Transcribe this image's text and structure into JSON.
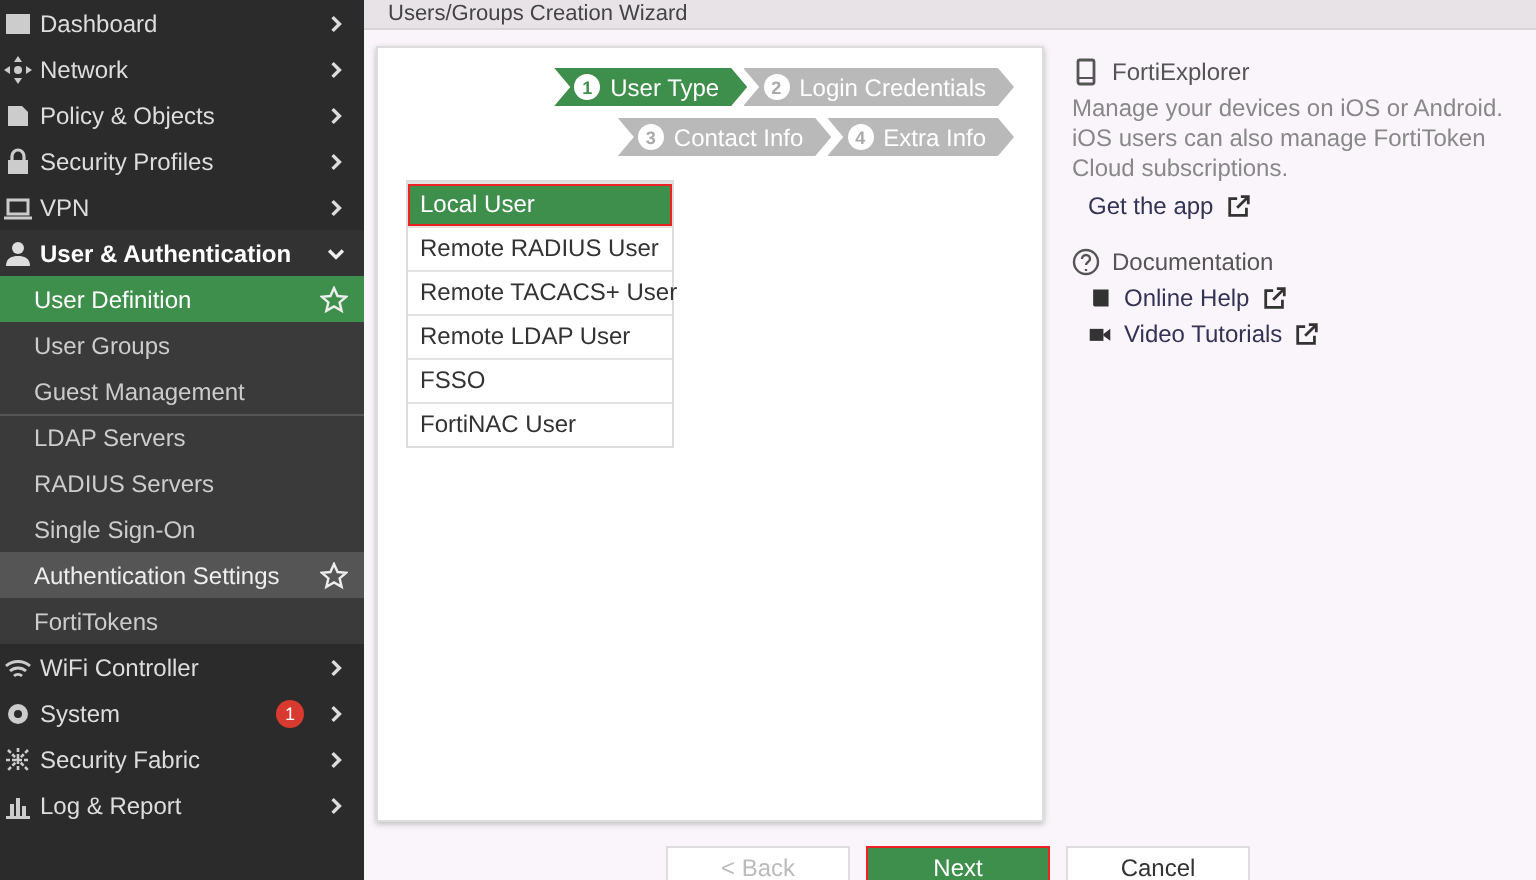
{
  "sidebar": {
    "items": [
      {
        "label": "Dashboard",
        "expanded": false
      },
      {
        "label": "Network",
        "expanded": false
      },
      {
        "label": "Policy & Objects",
        "expanded": false
      },
      {
        "label": "Security Profiles",
        "expanded": false
      },
      {
        "label": "VPN",
        "expanded": false
      },
      {
        "label": "User & Authentication",
        "expanded": true,
        "children": [
          {
            "label": "User Definition",
            "selected": true,
            "hovered": false,
            "divider_before": false
          },
          {
            "label": "User Groups",
            "selected": false,
            "hovered": false,
            "divider_before": false
          },
          {
            "label": "Guest Management",
            "selected": false,
            "hovered": false,
            "divider_before": false
          },
          {
            "label": "LDAP Servers",
            "selected": false,
            "hovered": false,
            "divider_before": true
          },
          {
            "label": "RADIUS Servers",
            "selected": false,
            "hovered": false,
            "divider_before": false
          },
          {
            "label": "Single Sign-On",
            "selected": false,
            "hovered": false,
            "divider_before": false
          },
          {
            "label": "Authentication Settings",
            "selected": false,
            "hovered": true,
            "divider_before": false
          },
          {
            "label": "FortiTokens",
            "selected": false,
            "hovered": false,
            "divider_before": false
          }
        ]
      },
      {
        "label": "WiFi Controller",
        "expanded": false
      },
      {
        "label": "System",
        "expanded": false,
        "badge": "1"
      },
      {
        "label": "Security Fabric",
        "expanded": false
      },
      {
        "label": "Log & Report",
        "expanded": false
      }
    ]
  },
  "wizard": {
    "title": "Users/Groups Creation Wizard",
    "steps": [
      {
        "number": "1",
        "label": "User Type",
        "selected": true
      },
      {
        "number": "2",
        "label": "Login Credentials",
        "selected": false
      },
      {
        "number": "3",
        "label": "Contact Info",
        "selected": false
      },
      {
        "number": "4",
        "label": "Extra Info",
        "selected": false
      }
    ],
    "user_types": [
      {
        "label": "Local User",
        "selected": true
      },
      {
        "label": "Remote RADIUS User",
        "selected": false
      },
      {
        "label": "Remote TACACS+ User",
        "selected": false
      },
      {
        "label": "Remote LDAP User",
        "selected": false
      },
      {
        "label": "FSSO",
        "selected": false
      },
      {
        "label": "FortiNAC User",
        "selected": false
      }
    ],
    "buttons": [
      {
        "label": "< Back",
        "kind": "secondary",
        "disabled": true
      },
      {
        "label": "Next",
        "kind": "primary",
        "disabled": false
      },
      {
        "label": "Cancel",
        "kind": "secondary",
        "disabled": false
      }
    ]
  },
  "info_panel": {
    "fortiexplorer": {
      "title": "FortiExplorer",
      "description": "Manage your devices on iOS or Android. iOS users can also manage FortiToken Cloud subscriptions.",
      "link": "Get the app"
    },
    "documentation": {
      "title": "Documentation",
      "links": [
        "Online Help",
        "Video Tutorials"
      ]
    }
  }
}
